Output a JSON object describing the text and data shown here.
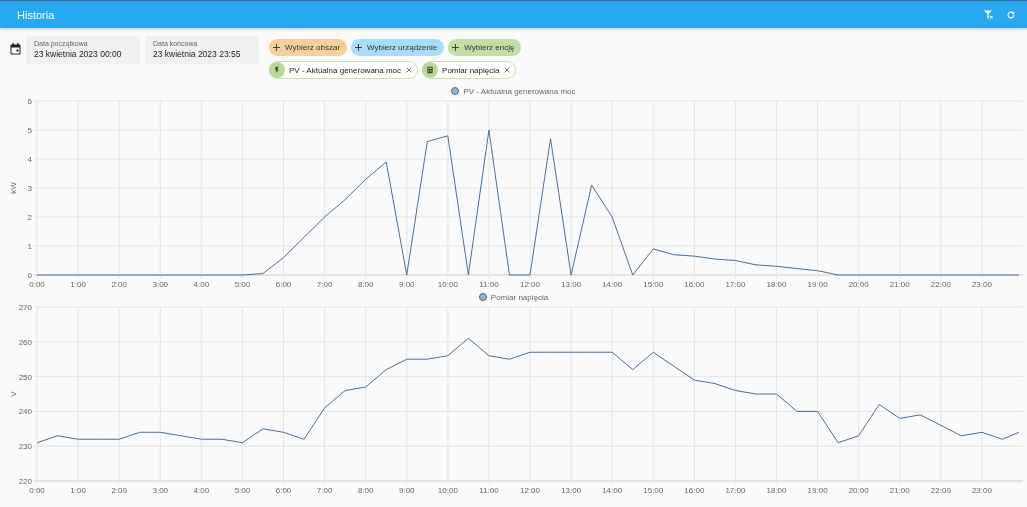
{
  "app_bar": {
    "title": "Historia"
  },
  "date_range": {
    "start": {
      "label": "Data początkowa",
      "value": "23 kwietnia 2023 00:00"
    },
    "end": {
      "label": "Data końcowa",
      "value": "23 kwietnia 2023 23:55"
    }
  },
  "target_pickers": [
    {
      "kind": "area",
      "label": "Wybierz obszar"
    },
    {
      "kind": "device",
      "label": "Wybierz urządzenie"
    },
    {
      "kind": "entity",
      "label": "Wybierz encję"
    }
  ],
  "selected_entities": [
    {
      "kind": "power",
      "label": "PV - Aktualna generowana moc"
    },
    {
      "kind": "meter",
      "label": "Pomiar napięcia"
    }
  ],
  "charts": [
    {
      "chart_data": {
        "type": "line",
        "ylabel": "kW",
        "x": [
          0,
          0.5,
          1,
          1.5,
          2,
          2.5,
          3,
          3.5,
          4,
          4.5,
          5,
          5.5,
          6,
          6.5,
          7,
          7.5,
          8,
          8.5,
          9,
          9.5,
          10,
          10.5,
          11,
          11.5,
          12,
          12.5,
          13,
          13.5,
          14,
          14.5,
          15,
          15.5,
          16,
          16.5,
          17,
          17.5,
          18,
          18.5,
          19,
          19.5,
          20,
          20.5,
          21,
          21.5,
          22,
          22.5,
          23,
          23.5,
          23.9
        ],
        "series": [
          {
            "name": "PV - Aktualna generowana moc",
            "color": "#4a6f98",
            "values": [
              0,
              0,
              0,
              0,
              0,
              0,
              0,
              0,
              0,
              0,
              0,
              0.05,
              0.6,
              1.3,
              2.0,
              2.6,
              3.3,
              3.9,
              0,
              4.6,
              4.8,
              0,
              5.0,
              0,
              0,
              4.7,
              0,
              3.1,
              2.0,
              0,
              0.9,
              0.7,
              0.65,
              0.55,
              0.5,
              0.35,
              0.3,
              0.22,
              0.15,
              0,
              0,
              0,
              0,
              0,
              0,
              0,
              0,
              0,
              0
            ]
          }
        ],
        "grid": true,
        "xlim": [
          0,
          24
        ],
        "ylim": [
          0,
          6
        ],
        "yticks": [
          0,
          1,
          2,
          3,
          4,
          5,
          6
        ],
        "xticks": [
          {
            "value": 0,
            "label": "0:00"
          },
          {
            "value": 1,
            "label": "1:00"
          },
          {
            "value": 2,
            "label": "2:00"
          },
          {
            "value": 3,
            "label": "3:00"
          },
          {
            "value": 4,
            "label": "4:00"
          },
          {
            "value": 5,
            "label": "5:00"
          },
          {
            "value": 6,
            "label": "6:00"
          },
          {
            "value": 7,
            "label": "7:00"
          },
          {
            "value": 8,
            "label": "8:00"
          },
          {
            "value": 9,
            "label": "9:00"
          },
          {
            "value": 10,
            "label": "10:00"
          },
          {
            "value": 11,
            "label": "11:00"
          },
          {
            "value": 12,
            "label": "12:00"
          },
          {
            "value": 13,
            "label": "13:00"
          },
          {
            "value": 14,
            "label": "14:00"
          },
          {
            "value": 15,
            "label": "15:00"
          },
          {
            "value": 16,
            "label": "16:00"
          },
          {
            "value": 17,
            "label": "17:00"
          },
          {
            "value": 18,
            "label": "18:00"
          },
          {
            "value": 19,
            "label": "19:00"
          },
          {
            "value": 20,
            "label": "20:00"
          },
          {
            "value": 21,
            "label": "21:00"
          },
          {
            "value": 22,
            "label": "22:00"
          },
          {
            "value": 23,
            "label": "23:00"
          }
        ]
      }
    },
    {
      "chart_data": {
        "type": "line",
        "ylabel": "V",
        "x": [
          0,
          0.5,
          1,
          1.5,
          2,
          2.5,
          3,
          3.5,
          4,
          4.5,
          5,
          5.5,
          6,
          6.5,
          7,
          7.5,
          8,
          8.5,
          9,
          9.5,
          10,
          10.5,
          11,
          11.5,
          12,
          12.5,
          13,
          13.5,
          14,
          14.5,
          15,
          15.5,
          16,
          16.5,
          17,
          17.5,
          18,
          18.5,
          19,
          19.5,
          20,
          20.5,
          21,
          21.5,
          22,
          22.5,
          23,
          23.5,
          23.9
        ],
        "series": [
          {
            "name": "Pomiar napięcia",
            "color": "#4a6f98",
            "values": [
              231,
              233,
              232,
              232,
              232,
              234,
              234,
              233,
              232,
              232,
              231,
              235,
              234,
              232,
              241,
              246,
              247,
              252,
              255,
              255,
              256,
              261,
              256,
              255,
              257,
              257,
              257,
              257,
              257,
              252,
              257,
              253,
              249,
              248,
              246,
              245,
              245,
              240,
              240,
              231,
              233,
              242,
              238,
              239,
              236,
              233,
              234,
              232,
              234
            ]
          }
        ],
        "grid": true,
        "xlim": [
          0,
          24
        ],
        "ylim": [
          220,
          270
        ],
        "yticks": [
          220,
          230,
          240,
          250,
          260,
          270
        ],
        "xticks": [
          {
            "value": 0,
            "label": "0:00"
          },
          {
            "value": 1,
            "label": "1:00"
          },
          {
            "value": 2,
            "label": "2:00"
          },
          {
            "value": 3,
            "label": "3:00"
          },
          {
            "value": 4,
            "label": "4:00"
          },
          {
            "value": 5,
            "label": "5:00"
          },
          {
            "value": 6,
            "label": "6:00"
          },
          {
            "value": 7,
            "label": "7:00"
          },
          {
            "value": 8,
            "label": "8:00"
          },
          {
            "value": 9,
            "label": "9:00"
          },
          {
            "value": 10,
            "label": "10:00"
          },
          {
            "value": 11,
            "label": "11:00"
          },
          {
            "value": 12,
            "label": "12:00"
          },
          {
            "value": 13,
            "label": "13:00"
          },
          {
            "value": 14,
            "label": "14:00"
          },
          {
            "value": 15,
            "label": "15:00"
          },
          {
            "value": 16,
            "label": "16:00"
          },
          {
            "value": 17,
            "label": "17:00"
          },
          {
            "value": 18,
            "label": "18:00"
          },
          {
            "value": 19,
            "label": "19:00"
          },
          {
            "value": 20,
            "label": "20:00"
          },
          {
            "value": 21,
            "label": "21:00"
          },
          {
            "value": 22,
            "label": "22:00"
          },
          {
            "value": 23,
            "label": "23:00"
          }
        ]
      }
    }
  ]
}
